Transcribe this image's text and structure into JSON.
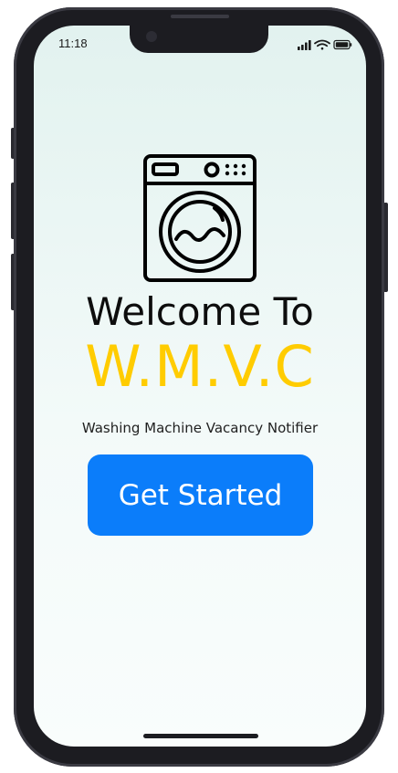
{
  "status_bar": {
    "time": "11:18",
    "icons": [
      "signal-icon",
      "wifi-icon",
      "battery-icon"
    ]
  },
  "welcome": {
    "heading": "Welcome To",
    "brand": "W.M.V.C",
    "tagline": "Washing Machine Vacancy Notifier",
    "cta_label": "Get Started"
  },
  "colors": {
    "brand_yellow": "#ffcc00",
    "button_blue": "#0b7dfa",
    "frame": "#1c1c21"
  },
  "logo_icon": "washing-machine-icon"
}
